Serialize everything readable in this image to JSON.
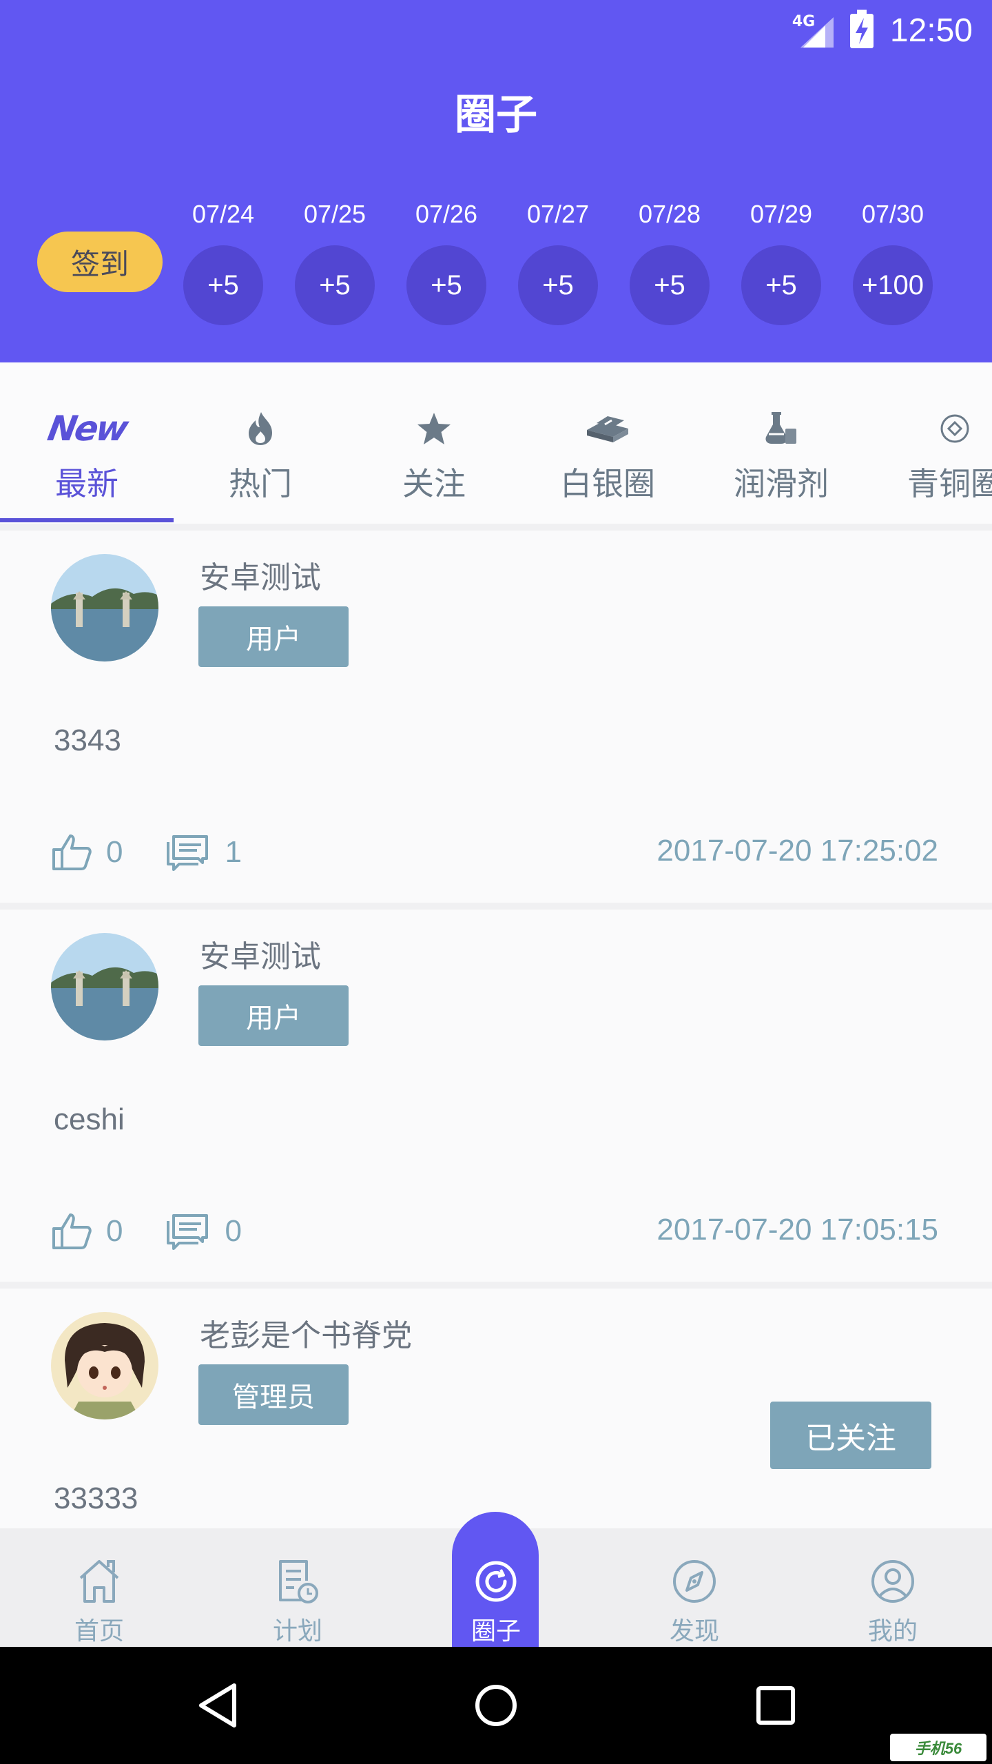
{
  "status_bar": {
    "network": "4G",
    "time": "12:50"
  },
  "header": {
    "title": "圈子"
  },
  "checkin": {
    "button_label": "签到",
    "days": [
      {
        "date": "07/24",
        "points": "+5"
      },
      {
        "date": "07/25",
        "points": "+5"
      },
      {
        "date": "07/26",
        "points": "+5"
      },
      {
        "date": "07/27",
        "points": "+5"
      },
      {
        "date": "07/28",
        "points": "+5"
      },
      {
        "date": "07/29",
        "points": "+5"
      },
      {
        "date": "07/30",
        "points": "+100"
      }
    ]
  },
  "tabs": [
    {
      "label": "最新",
      "icon": "new-icon",
      "active": true
    },
    {
      "label": "热门",
      "icon": "flame-icon"
    },
    {
      "label": "关注",
      "icon": "star-icon"
    },
    {
      "label": "白银圈",
      "icon": "silver-bars-icon"
    },
    {
      "label": "润滑剂",
      "icon": "flask-icon"
    },
    {
      "label": "青铜圈",
      "icon": "coin-icon"
    }
  ],
  "posts": [
    {
      "author": "安卓测试",
      "role": "用户",
      "content": "3343",
      "likes": "0",
      "comments": "1",
      "time": "2017-07-20 17:25:02"
    },
    {
      "author": "安卓测试",
      "role": "用户",
      "content": "ceshi",
      "likes": "0",
      "comments": "0",
      "time": "2017-07-20 17:05:15"
    },
    {
      "author": "老彭是个书脊党",
      "role": "管理员",
      "content": "33333",
      "follow_label": "已关注"
    }
  ],
  "bottom_nav": [
    {
      "label": "首页",
      "icon": "home-icon"
    },
    {
      "label": "计划",
      "icon": "plan-icon"
    },
    {
      "label": "圈子",
      "icon": "circle-icon",
      "active": true
    },
    {
      "label": "发现",
      "icon": "compass-icon"
    },
    {
      "label": "我的",
      "icon": "profile-icon"
    }
  ],
  "watermark": "手机56",
  "colors": {
    "primary": "#6157f2",
    "checkin_yellow": "#f6c650",
    "badge": "#7ea5b8"
  }
}
